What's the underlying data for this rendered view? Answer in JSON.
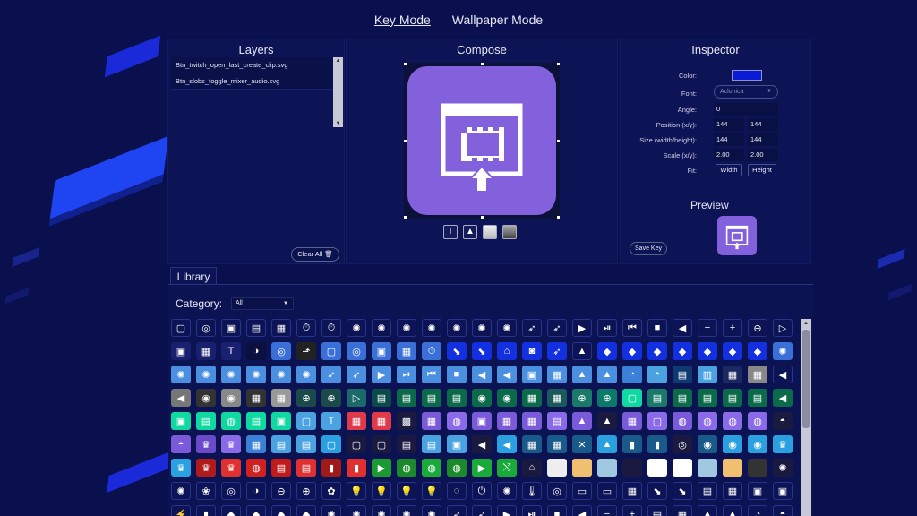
{
  "modes": [
    "Key Mode",
    "Wallpaper Mode"
  ],
  "layers": {
    "title": "Layers",
    "items": [
      "Btn_twitch_open_last_create_clip.svg",
      "Btn_slobs_toggle_mixer_audio.svg"
    ],
    "clear_label": "Clear All",
    "clear_icon": "trash-icon"
  },
  "compose": {
    "title": "Compose",
    "tools": [
      "text-tool-icon",
      "image-tool-icon",
      "light-bg-icon",
      "dark-bg-icon"
    ],
    "tool_glyphs": [
      "T",
      "▲",
      "",
      ""
    ]
  },
  "inspector": {
    "title": "Inspector",
    "color_label": "Color:",
    "color_value": "#0a1bd6",
    "font_label": "Font:",
    "font_value": "Aclonica",
    "angle_label": "Angle:",
    "angle_value": "0",
    "position_label": "Position (x/y):",
    "position_x": "144",
    "position_y": "144",
    "size_label": "Size (width/height):",
    "size_w": "144",
    "size_h": "144",
    "scale_label": "Scale (x/y):",
    "scale_x": "2.00",
    "scale_y": "2.00",
    "fit_label": "Fit:",
    "fit_width": "Width",
    "fit_height": "Height",
    "preview_title": "Preview",
    "save_label": "Save Key"
  },
  "library": {
    "tab": "Library",
    "category_label": "Category:",
    "category_value": "All",
    "rows": [
      [
        "#0d1456",
        "#0d1456",
        "#0d1456",
        "#0d1456",
        "#0d1456",
        "#0d1456",
        "#0d1456",
        "#0d1456",
        "#0d1456",
        "#0d1456",
        "#0d1456",
        "#0d1456",
        "#0d1456",
        "#0d1456",
        "#0d1456",
        "#0d1456",
        "#0d1456",
        "#0d1456",
        "#0d1456",
        "#0d1456",
        "#0d1456",
        "#0d1456",
        "#0d1456",
        "#0d1456",
        "#0d1456"
      ],
      [
        "#1a2070",
        "#1a2070",
        "#1a2070",
        "#0b1040",
        "#3a6fd8",
        "#222",
        "#3a6fd8",
        "#3a6fd8",
        "#3a6fd8",
        "#3a6fd8",
        "#3a6fd8",
        "#1230e0",
        "#1230e0",
        "#1230e0",
        "#1230e0",
        "#1230e0",
        "#0d1456",
        "#1230e0",
        "#1230e0",
        "#1230e0",
        "#1230e0",
        "#1230e0",
        "#1230e0",
        "#1230e0",
        "#3a6fd8"
      ],
      [
        "#4a8fe0",
        "#4a8fe0",
        "#4a8fe0",
        "#4a8fe0",
        "#4a8fe0",
        "#4a8fe0",
        "#4a8fe0",
        "#4a8fe0",
        "#4a8fe0",
        "#4a8fe0",
        "#4a8fe0",
        "#4a8fe0",
        "#4a8fe0",
        "#4a8fe0",
        "#4a8fe0",
        "#4a8fe0",
        "#4a8fe0",
        "#4a8fe0",
        "#3a7fd8",
        "#4aa3e0",
        "#0d3a70",
        "#4aa3e0",
        "#1a2a60",
        "#888",
        "#0d1456"
      ],
      [
        "#777",
        "#333",
        "#888",
        "#333",
        "#999",
        "#1a4a4a",
        "#1a4a4a",
        "#1a6a6a",
        "#0b4a4a",
        "#0b6a4a",
        "#0b6a4a",
        "#0b6a4a",
        "#0b6a4a",
        "#0b6a4a",
        "#0b6a4a",
        "#1a5a5a",
        "#1a7a6a",
        "#0b7a6a",
        "#0fd9a0",
        "#1a7a6a",
        "#0b6a4a",
        "#0b6a4a",
        "#0b6a4a",
        "#0b6a4a",
        "#0b6a4a"
      ],
      [
        "#0fd9a0",
        "#0fd9a0",
        "#0fd9a0",
        "#0fd9a0",
        "#0fd9a0",
        "#4aa3e0",
        "#4aa3e0",
        "#e03a4a",
        "#e03a4a",
        "#1a1a40",
        "#7a5ad8",
        "#8a6ae8",
        "#7a5ad8",
        "#7a5ad8",
        "#7a5ad8",
        "#8a6ae8",
        "#7a5ad8",
        "#1a1a40",
        "#7a5ad8",
        "#8a6ae8",
        "#7a5ad8",
        "#8a6ae8",
        "#8a6ae8",
        "#8a6ae8",
        "#1a1a40"
      ],
      [
        "#7a5ad8",
        "#6a4ac8",
        "#8a6ae8",
        "#3a7fd8",
        "#4aa3e0",
        "#4aa3e0",
        "#2aa0e0",
        "#1a1a40",
        "#1a1a40",
        "#1a1a40",
        "#4aa3e0",
        "#4aa3e0",
        "#1a1a40",
        "#2aa0e0",
        "#1a5a8a",
        "#1a5a8a",
        "#1a5a8a",
        "#2aa0e0",
        "#1a5a8a",
        "#1a5a8a",
        "#1a1a40",
        "#1a5a8a",
        "#2aa0e0",
        "#2aa0e0",
        "#2aa0e0"
      ],
      [
        "#2aa0e0",
        "#b01a1a",
        "#e03030",
        "#d02020",
        "#c01a1a",
        "#e03030",
        "#a01a1a",
        "#e03030",
        "#1a9a30",
        "#1a8a2a",
        "#1aaa3a",
        "#1a8a2a",
        "#1aaa3a",
        "#1aaa3a",
        "#1a1a40",
        "#eeeeee",
        "#f0c070",
        "#a0c8e0",
        "#1a1a40",
        "#ffffff",
        "#ffffff",
        "#a0c8e0",
        "#f0c070",
        "#333333",
        "#1a1a40"
      ],
      [
        "#0d1456",
        "#0d1456",
        "#0d1456",
        "#0d1456",
        "#0d1456",
        "#0d1456",
        "#0d1456",
        "#0d1456",
        "#0d1456",
        "#0d1456",
        "#0d1456",
        "#0d1456",
        "#0d1456",
        "#0d1456",
        "#0d1456",
        "#0d1456",
        "#0d1456",
        "#0d1456",
        "#0d1456",
        "#0d1456",
        "#0d1456",
        "#0d1456",
        "#0d1456",
        "#0d1456",
        "#0d1456"
      ],
      [
        "#0d1456",
        "#0d1456",
        "#0d1456",
        "#0d1456",
        "#0d1456",
        "#0d1456",
        "#0d1456",
        "#0d1456",
        "#0d1456",
        "#0d1456",
        "#0d1456",
        "#0d1456",
        "#0d1456",
        "#0d1456",
        "#0d1456",
        "#0d1456",
        "#0d1456",
        "#0d1456",
        "#0d1456",
        "#0d1456",
        "#0d1456",
        "#0d1456",
        "#0d1456",
        "#0d1456",
        "#0d1456"
      ]
    ],
    "glyphs": [
      [
        "▢",
        "◎",
        "▣",
        "▤",
        "▦",
        "⏱",
        "⏱",
        "✺",
        "✺",
        "✺",
        "✺",
        "✺",
        "✺",
        "✺",
        "➶",
        "➶",
        "▶",
        "⏯",
        "⏮",
        "■",
        "◀",
        "−",
        "+",
        "⊖",
        "▷"
      ],
      [
        "▣",
        "▦",
        "T",
        "◑",
        "◎",
        "⬏",
        "▢",
        "◎",
        "▣",
        "▦",
        "⏱",
        "⬊",
        "⬊",
        "⌂",
        "◙",
        "➶",
        "▲",
        "◆",
        "◆",
        "◆",
        "◆",
        "◆",
        "◆",
        "◆",
        "✺"
      ],
      [
        "✺",
        "✺",
        "✺",
        "✺",
        "✺",
        "✺",
        "➶",
        "➶",
        "▶",
        "⏯",
        "⏮",
        "■",
        "◀",
        "◀",
        "▣",
        "▦",
        "▲",
        "▲",
        "◔",
        "◓",
        "▤",
        "▥",
        "▦",
        "▦",
        "◀"
      ],
      [
        "◀",
        "◉",
        "◉",
        "▦",
        "▦",
        "⊕",
        "⊕",
        "▷",
        "▤",
        "▤",
        "▤",
        "▤",
        "◉",
        "◉",
        "▦",
        "▦",
        "⊕",
        "⊕",
        "▢",
        "▤",
        "▤",
        "▤",
        "▤",
        "▤",
        "◀"
      ],
      [
        "▣",
        "▤",
        "◍",
        "▤",
        "▣",
        "▢",
        "T",
        "▦",
        "▦",
        "▩",
        "▦",
        "◍",
        "▣",
        "▦",
        "▦",
        "▤",
        "▲",
        "▲",
        "▦",
        "▢",
        "◍",
        "◍",
        "◍",
        "◍",
        "◓"
      ],
      [
        "◓",
        "♛",
        "♛",
        "▦",
        "▤",
        "▤",
        "▢",
        "▢",
        "▢",
        "▤",
        "▤",
        "▣",
        "◀",
        "◀",
        "▦",
        "▦",
        "✕",
        "▲",
        "▮",
        "▮",
        "◎",
        "◉",
        "◉",
        "◉",
        "♛"
      ],
      [
        "♛",
        "♛",
        "♛",
        "◍",
        "▤",
        "▤",
        "▮",
        "▮",
        "▶",
        "◍",
        "◍",
        "◍",
        "▶",
        "⤭",
        "⌂",
        "",
        "",
        "",
        "",
        "",
        "",
        "",
        "",
        "",
        "✺"
      ],
      [
        "✺",
        "❀",
        "◎",
        "◑",
        "⊖",
        "⊕",
        "✿",
        "💡",
        "💡",
        "💡",
        "💡",
        "◌",
        "⏻",
        "✺",
        "🌡",
        "◎",
        "▭",
        "▭",
        "▦",
        "⬊",
        "⬊",
        "▤",
        "▦",
        "▣",
        "▣"
      ],
      [
        "⚡",
        "▮",
        "◆",
        "◆",
        "◆",
        "◆",
        "✺",
        "✺",
        "✺",
        "✺",
        "✺",
        "➶",
        "➶",
        "▶",
        "⏯",
        "■",
        "◀",
        "−",
        "+",
        "▤",
        "▦",
        "▲",
        "▲",
        "◔",
        "◓"
      ]
    ]
  }
}
